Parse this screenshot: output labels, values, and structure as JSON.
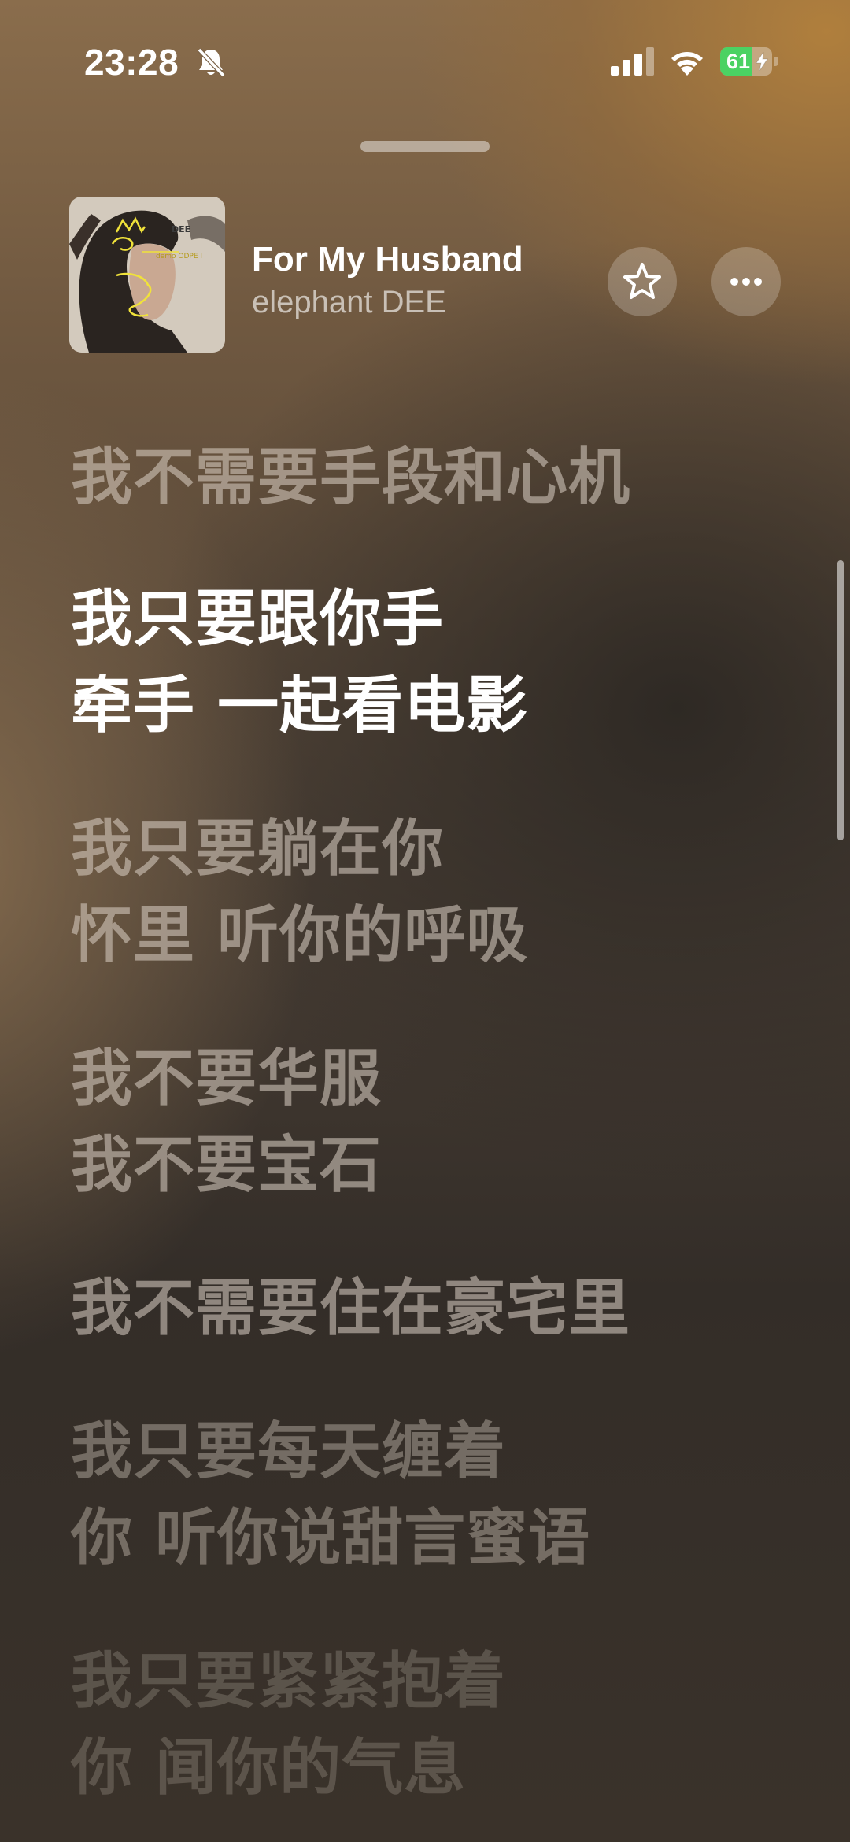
{
  "status_bar": {
    "time": "23:28",
    "battery_level": "61",
    "battery_fraction": 0.61,
    "icons": [
      "bell-slash-icon",
      "cellular-signal-icon",
      "wifi-icon",
      "battery-charging-icon"
    ]
  },
  "now_playing": {
    "title": "For My Husband",
    "artist": "elephant DEE",
    "buttons": [
      "star-icon",
      "more-icon"
    ]
  },
  "lyrics": [
    {
      "text": "我不需要手段和心机",
      "state": "past"
    },
    {
      "text": "我只要跟你手",
      "state": "active"
    },
    {
      "text": "牵手 一起看电影",
      "state": "active"
    },
    {
      "text": "我只要躺在你",
      "state": "upcoming"
    },
    {
      "text": "怀里 听你的呼吸",
      "state": "upcoming"
    },
    {
      "text": "我不要华服",
      "state": "upcoming"
    },
    {
      "text": "我不要宝石",
      "state": "upcoming"
    },
    {
      "text": "我不需要住在豪宅里",
      "state": "upcoming"
    },
    {
      "text": "我只要每天缠着",
      "state": "upcoming"
    },
    {
      "text": "你 听你说甜言蜜语",
      "state": "upcoming"
    },
    {
      "text": "我只要紧紧抱着",
      "state": "upcoming"
    },
    {
      "text": "你 闻你的气息",
      "state": "upcoming"
    }
  ],
  "colors": {
    "accent_battery": "#4bd263",
    "active_lyric": "#ffffff"
  }
}
